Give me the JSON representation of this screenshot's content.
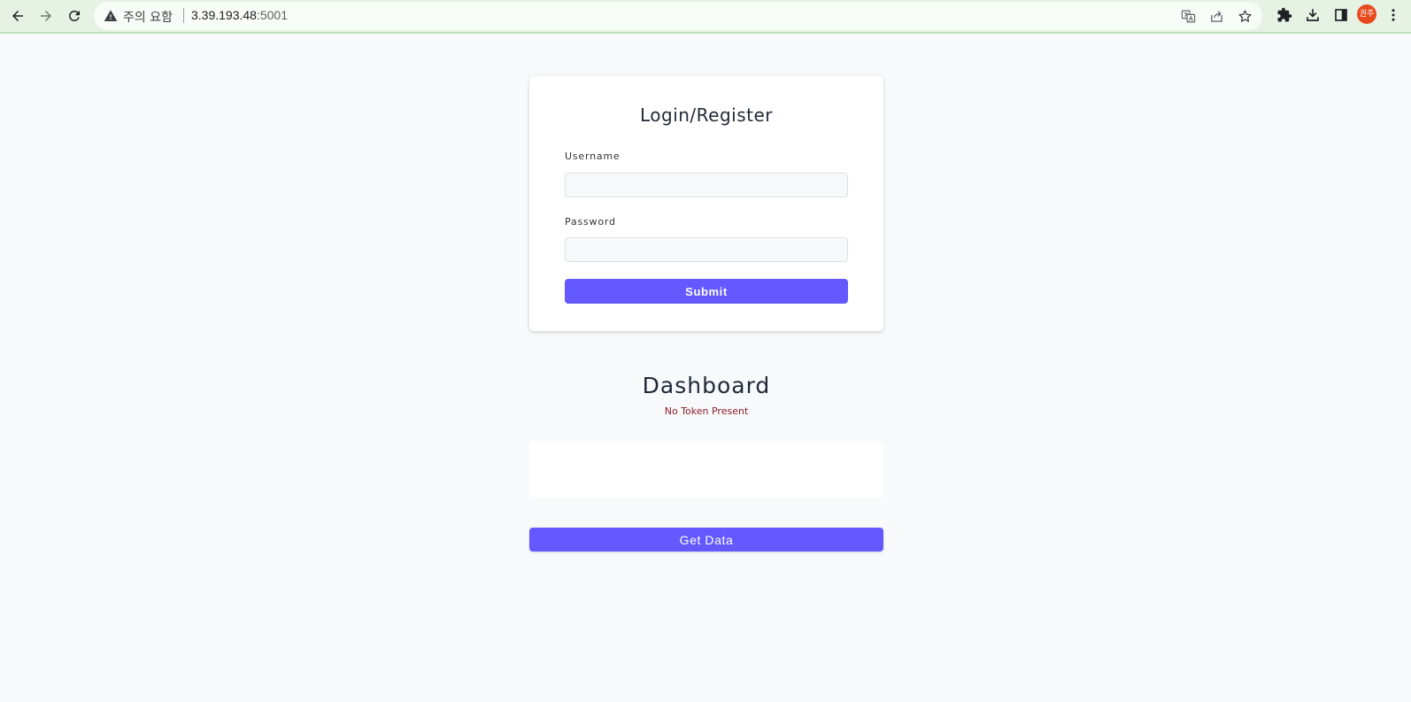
{
  "browser": {
    "security_label": "주의 요함",
    "url_host": "3.39.193.48",
    "url_port": ":5001",
    "profile_initials": "권주",
    "accent_color": "#e6f2e4"
  },
  "icons": {
    "back": "arrow-left-icon",
    "forward": "arrow-right-icon",
    "reload": "reload-icon",
    "warning": "warning-triangle-icon",
    "translate": "translate-icon",
    "share": "share-icon",
    "bookmark": "star-icon",
    "extensions": "puzzle-icon",
    "download": "download-icon",
    "side_panel": "side-panel-icon",
    "menu": "kebab-menu-icon"
  },
  "login": {
    "title": "Login/Register",
    "username_label": "Username",
    "username_value": "",
    "password_label": "Password",
    "password_value": "",
    "submit_label": "Submit"
  },
  "dashboard": {
    "title": "Dashboard",
    "status": "No Token Present",
    "data_output": "",
    "get_data_label": "Get Data"
  },
  "colors": {
    "primary_button": "#6359ff",
    "status_text": "#8b1f2b",
    "page_background": "#f8f9fb"
  }
}
